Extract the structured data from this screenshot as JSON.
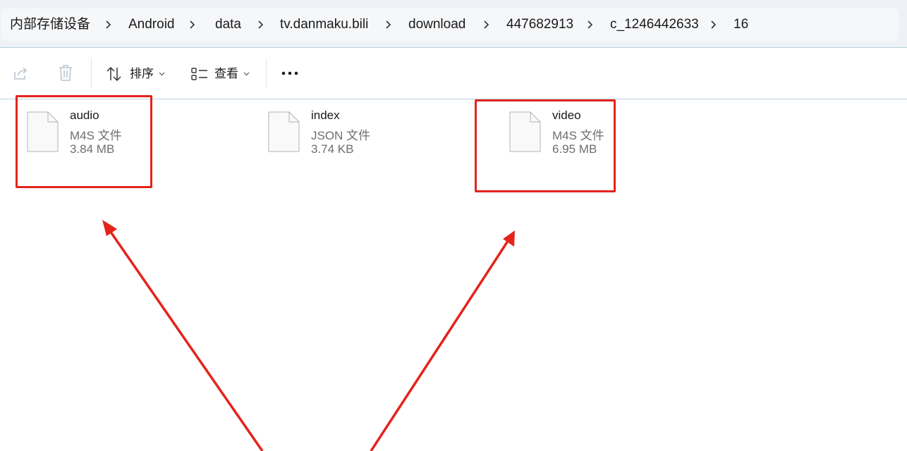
{
  "breadcrumb": {
    "items": [
      {
        "label": "内部存储设备"
      },
      {
        "label": "Android"
      },
      {
        "label": "data"
      },
      {
        "label": "tv.danmaku.bili"
      },
      {
        "label": "download"
      },
      {
        "label": "447682913"
      },
      {
        "label": "c_1246442633"
      },
      {
        "label": "16"
      }
    ]
  },
  "toolbar": {
    "share_icon": "share-icon",
    "delete_icon": "trash-icon",
    "sort_label": "排序",
    "view_label": "查看",
    "more_icon": "more-icon"
  },
  "files": [
    {
      "name": "audio",
      "type": "M4S 文件",
      "size": "3.84 MB",
      "highlighted": true
    },
    {
      "name": "index",
      "type": "JSON 文件",
      "size": "3.74 KB",
      "highlighted": false
    },
    {
      "name": "video",
      "type": "M4S 文件",
      "size": "6.95 MB",
      "highlighted": true
    }
  ],
  "annotation": {
    "color": "#e4231b"
  }
}
